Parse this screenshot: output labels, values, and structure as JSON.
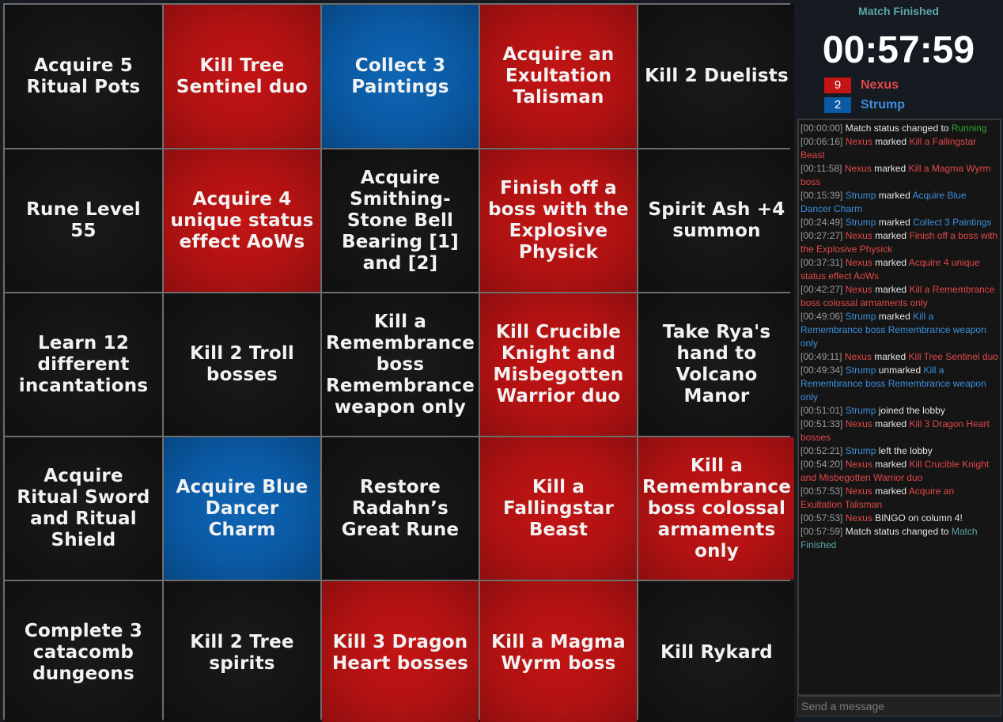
{
  "board": {
    "cells": [
      {
        "text": "Acquire 5 Ritual Pots",
        "color": "none"
      },
      {
        "text": "Kill Tree Sentinel duo",
        "color": "red"
      },
      {
        "text": "Collect 3 Paintings",
        "color": "blue"
      },
      {
        "text": "Acquire an Exultation Talisman",
        "color": "red"
      },
      {
        "text": "Kill 2 Duelists",
        "color": "none"
      },
      {
        "text": "Rune Level 55",
        "color": "none"
      },
      {
        "text": "Acquire 4 unique status effect AoWs",
        "color": "red"
      },
      {
        "text": "Acquire Smithing-Stone Bell Bearing [1] and [2]",
        "color": "none"
      },
      {
        "text": "Finish off a boss with the Explosive Physick",
        "color": "red"
      },
      {
        "text": "Spirit Ash +4 summon",
        "color": "none"
      },
      {
        "text": "Learn 12 different incantations",
        "color": "none"
      },
      {
        "text": "Kill 2 Troll bosses",
        "color": "none"
      },
      {
        "text": "Kill a Remembrance boss Remembrance weapon only",
        "color": "none"
      },
      {
        "text": "Kill Crucible Knight and Misbegotten Warrior duo",
        "color": "red"
      },
      {
        "text": "Take Rya's hand to Volcano Manor",
        "color": "none"
      },
      {
        "text": "Acquire Ritual Sword and Ritual Shield",
        "color": "none"
      },
      {
        "text": "Acquire Blue Dancer Charm",
        "color": "blue"
      },
      {
        "text": "Restore Radahn’s Great Rune",
        "color": "none"
      },
      {
        "text": "Kill a Fallingstar Beast",
        "color": "red"
      },
      {
        "text": "Kill a Remembrance boss colossal armaments only",
        "color": "red"
      },
      {
        "text": "Complete 3 catacomb dungeons",
        "color": "none"
      },
      {
        "text": "Kill 2 Tree spirits",
        "color": "none"
      },
      {
        "text": "Kill 3 Dragon Heart bosses",
        "color": "red"
      },
      {
        "text": "Kill a Magma Wyrm boss",
        "color": "red"
      },
      {
        "text": "Kill Rykard",
        "color": "none"
      }
    ]
  },
  "status": "Match Finished",
  "timer": "00:57:59",
  "players": [
    {
      "name": "Nexus",
      "score": "9",
      "color": "#e34848",
      "badge": "#c41414"
    },
    {
      "name": "Strump",
      "score": "2",
      "color": "#3d8fdb",
      "badge": "#0a59a3"
    }
  ],
  "log": [
    {
      "time": "[00:00:00]",
      "parts": [
        {
          "t": "Match status changed to ",
          "c": ""
        },
        {
          "t": "Running",
          "c": "green"
        }
      ]
    },
    {
      "time": "[00:06:16]",
      "parts": [
        {
          "t": "Nexus",
          "c": "red"
        },
        {
          "t": " marked ",
          "c": ""
        },
        {
          "t": "Kill a Fallingstar Beast",
          "c": "red"
        }
      ]
    },
    {
      "time": "[00:11:58]",
      "parts": [
        {
          "t": "Nexus",
          "c": "red"
        },
        {
          "t": " marked ",
          "c": ""
        },
        {
          "t": "Kill a Magma Wyrm boss",
          "c": "red"
        }
      ]
    },
    {
      "time": "[00:15:39]",
      "parts": [
        {
          "t": "Strump",
          "c": "blue"
        },
        {
          "t": " marked ",
          "c": ""
        },
        {
          "t": "Acquire Blue Dancer Charm",
          "c": "blue"
        }
      ]
    },
    {
      "time": "[00:24:49]",
      "parts": [
        {
          "t": "Strump",
          "c": "blue"
        },
        {
          "t": " marked ",
          "c": ""
        },
        {
          "t": "Collect 3 Paintings",
          "c": "blue"
        }
      ]
    },
    {
      "time": "[00:27:27]",
      "parts": [
        {
          "t": "Nexus",
          "c": "red"
        },
        {
          "t": " marked ",
          "c": ""
        },
        {
          "t": "Finish off a boss with the Explosive Physick",
          "c": "red"
        }
      ]
    },
    {
      "time": "[00:37:31]",
      "parts": [
        {
          "t": "Nexus",
          "c": "red"
        },
        {
          "t": " marked ",
          "c": ""
        },
        {
          "t": "Acquire 4 unique status effect AoWs",
          "c": "red"
        }
      ]
    },
    {
      "time": "[00:42:27]",
      "parts": [
        {
          "t": "Nexus",
          "c": "red"
        },
        {
          "t": " marked ",
          "c": ""
        },
        {
          "t": "Kill a Remembrance boss colossal armaments only",
          "c": "red"
        }
      ]
    },
    {
      "time": "[00:49:06]",
      "parts": [
        {
          "t": "Strump",
          "c": "blue"
        },
        {
          "t": " marked ",
          "c": ""
        },
        {
          "t": "Kill a Remembrance boss Remembrance weapon only",
          "c": "blue"
        }
      ]
    },
    {
      "time": "[00:49:11]",
      "parts": [
        {
          "t": "Nexus",
          "c": "red"
        },
        {
          "t": " marked ",
          "c": ""
        },
        {
          "t": "Kill Tree Sentinel duo",
          "c": "red"
        }
      ]
    },
    {
      "time": "[00:49:34]",
      "parts": [
        {
          "t": "Strump",
          "c": "blue"
        },
        {
          "t": " unmarked ",
          "c": ""
        },
        {
          "t": "Kill a Remembrance boss Remembrance weapon only",
          "c": "blue"
        }
      ]
    },
    {
      "time": "[00:51:01]",
      "parts": [
        {
          "t": "Strump",
          "c": "blue"
        },
        {
          "t": " joined the lobby",
          "c": ""
        }
      ]
    },
    {
      "time": "[00:51:33]",
      "parts": [
        {
          "t": "Nexus",
          "c": "red"
        },
        {
          "t": " marked ",
          "c": ""
        },
        {
          "t": "Kill 3 Dragon Heart bosses",
          "c": "red"
        }
      ]
    },
    {
      "time": "[00:52:21]",
      "parts": [
        {
          "t": "Strump",
          "c": "blue"
        },
        {
          "t": " left the lobby",
          "c": ""
        }
      ]
    },
    {
      "time": "[00:54:20]",
      "parts": [
        {
          "t": "Nexus",
          "c": "red"
        },
        {
          "t": " marked ",
          "c": ""
        },
        {
          "t": "Kill Crucible Knight and Misbegotten Warrior duo",
          "c": "red"
        }
      ]
    },
    {
      "time": "[00:57:53]",
      "parts": [
        {
          "t": "Nexus",
          "c": "red"
        },
        {
          "t": " marked ",
          "c": ""
        },
        {
          "t": "Acquire an Exultation Talisman",
          "c": "red"
        }
      ]
    },
    {
      "time": "[00:57:53]",
      "parts": [
        {
          "t": "Nexus",
          "c": "red"
        },
        {
          "t": " BINGO on column 4!",
          "c": ""
        }
      ]
    },
    {
      "time": "[00:57:59]",
      "parts": [
        {
          "t": "Match status changed to ",
          "c": ""
        },
        {
          "t": "Match Finished",
          "c": "teal"
        }
      ]
    }
  ],
  "chat": {
    "placeholder": "Send a message"
  }
}
